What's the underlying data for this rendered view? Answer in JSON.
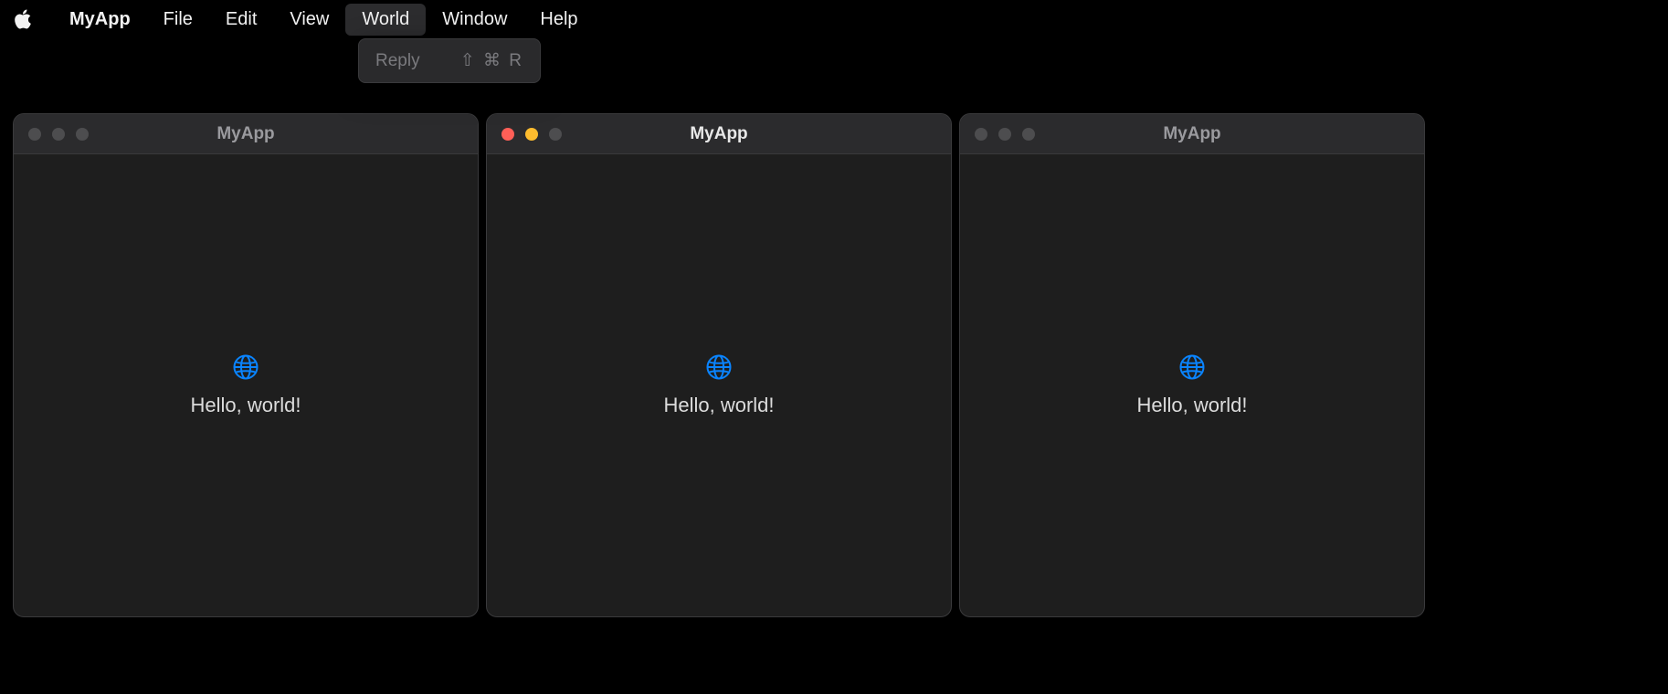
{
  "menubar": {
    "app_name": "MyApp",
    "items": [
      "File",
      "Edit",
      "View",
      "World",
      "Window",
      "Help"
    ],
    "active_index": 3
  },
  "dropdown": {
    "items": [
      {
        "label": "Reply",
        "shortcut": "⇧ ⌘ R",
        "enabled": false
      }
    ]
  },
  "windows": [
    {
      "title": "MyApp",
      "content_text": "Hello, world!",
      "focused": false,
      "icon": "globe-icon"
    },
    {
      "title": "MyApp",
      "content_text": "Hello, world!",
      "focused": true,
      "icon": "globe-icon"
    },
    {
      "title": "MyApp",
      "content_text": "Hello, world!",
      "focused": false,
      "icon": "globe-icon"
    }
  ],
  "colors": {
    "accent": "#0a84ff",
    "window_bg": "#1e1e1e",
    "titlebar_bg": "#2b2b2d",
    "traffic_close": "#ff5f57",
    "traffic_min": "#febc2e"
  }
}
